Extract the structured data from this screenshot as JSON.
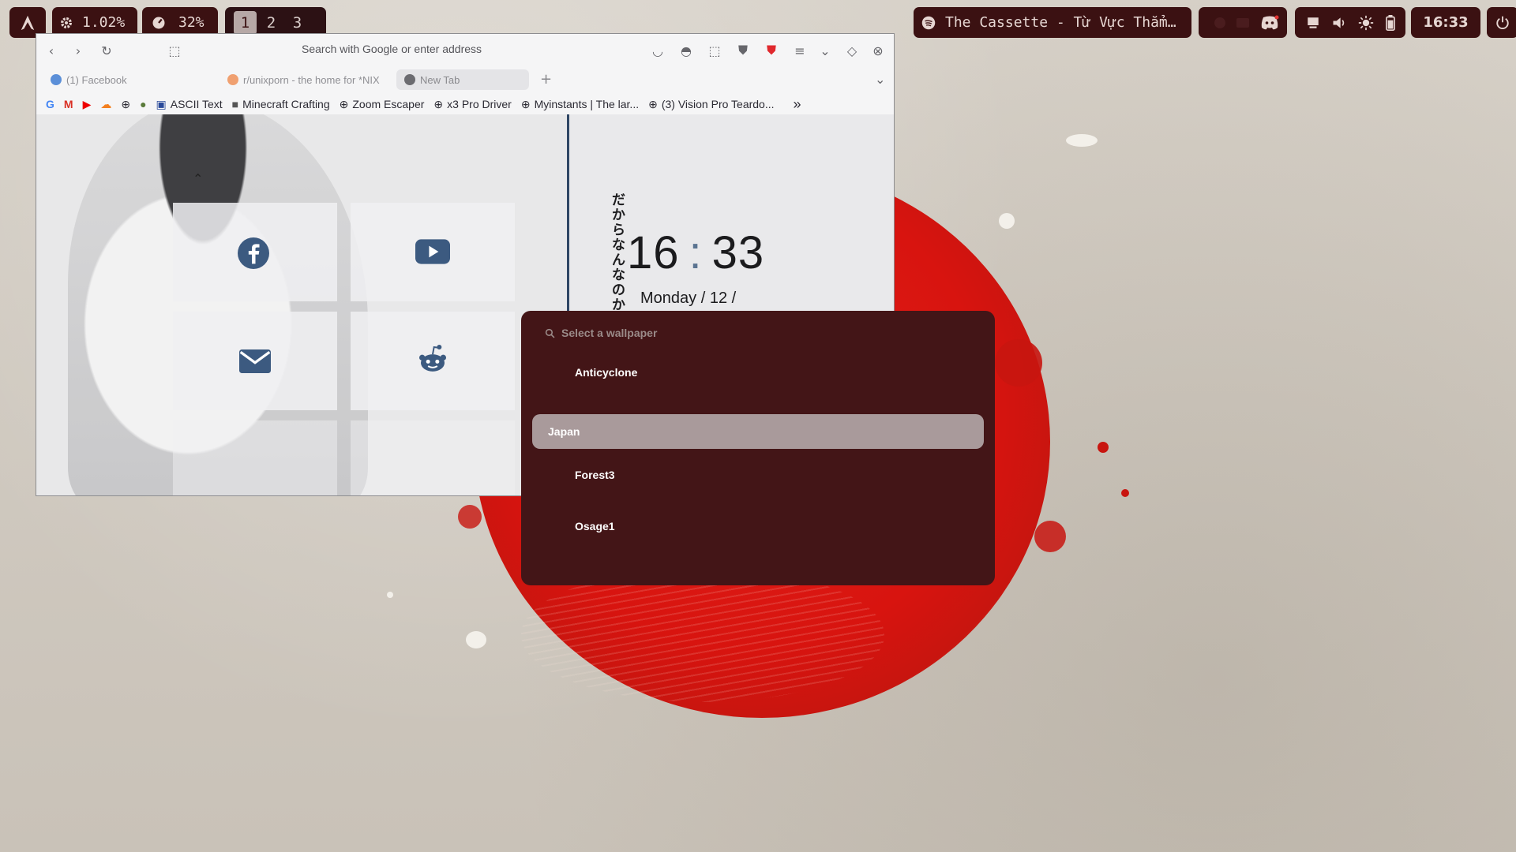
{
  "topbar": {
    "launcher_icon": "arch-logo-icon",
    "cpu": {
      "icon": "gear-icon",
      "value": "1.02%"
    },
    "memory": {
      "icon": "gauge-icon",
      "value": "32%"
    },
    "workspaces": [
      "1",
      "2",
      "3"
    ],
    "active_workspace": "1",
    "media": {
      "icon": "spotify-icon",
      "title": "The Cassette - Từ Vực Thẳm…"
    },
    "tray_icons": [
      "discord-icon"
    ],
    "status_icons": [
      "display-icon",
      "volume-icon",
      "brightness-icon",
      "battery-icon"
    ],
    "clock": "16:33",
    "power_icon": "power-icon"
  },
  "browser": {
    "address_placeholder": "Search with Google or enter address",
    "tabs": [
      {
        "title": "(1) Facebook"
      },
      {
        "title": "r/unixporn - the home for *NIX"
      },
      {
        "title": "New Tab",
        "active": true
      }
    ],
    "bookmarks": [
      "ASCII Text",
      "Minecraft Crafting",
      "Zoom Escaper",
      "x3 Pro Driver",
      "Myinstants | The lar...",
      "(3) Vision Pro Teardo..."
    ],
    "newtab": {
      "clock_hours": "16",
      "clock_sep": ":",
      "clock_minutes": "33",
      "japanese_text": "だからなんなのか",
      "date": "Monday / 12 /"
    }
  },
  "wallpaper_picker": {
    "search_placeholder": "Select a wallpaper",
    "items": [
      "Anticyclone",
      "Japan",
      "Forest3",
      "Osage1"
    ],
    "selected": "Japan"
  }
}
